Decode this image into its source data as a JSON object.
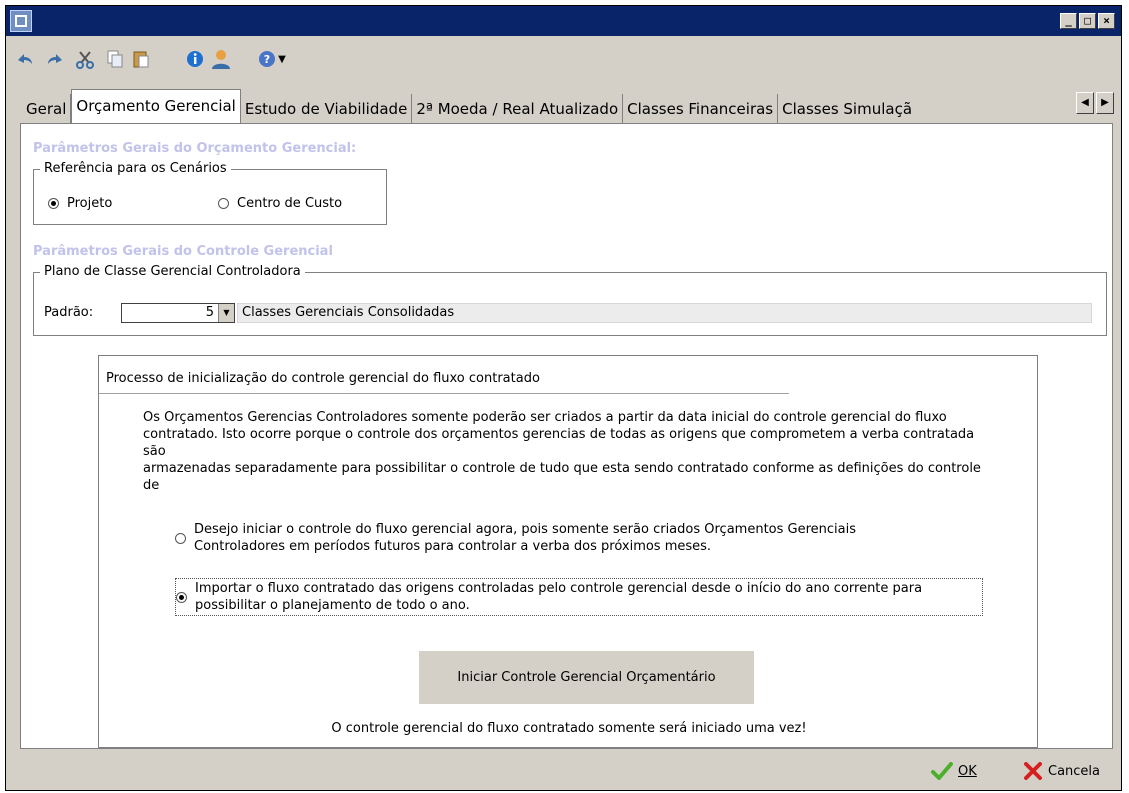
{
  "window": {
    "controls": [
      "_",
      "□",
      "×"
    ]
  },
  "toolbar": {
    "icons": [
      "undo-icon",
      "redo-icon",
      "cut-icon",
      "copy-icon",
      "paste-icon",
      "info-icon",
      "user-icon",
      "help-icon"
    ]
  },
  "tabs": [
    {
      "label": "Geral",
      "active": false
    },
    {
      "label": "Orçamento Gerencial",
      "active": true
    },
    {
      "label": "Estudo de Viabilidade",
      "active": false
    },
    {
      "label": "2ª Moeda / Real Atualizado",
      "active": false
    },
    {
      "label": "Classes Financeiras",
      "active": false
    },
    {
      "label": "Classes Simulaçã",
      "active": false
    }
  ],
  "orcamento": {
    "section_title": "Parâmetros Gerais do Orçamento Gerencial:",
    "group_label": "Referência para os Cenários",
    "options": [
      {
        "label": "Projeto",
        "selected": true
      },
      {
        "label": "Centro de Custo",
        "selected": false
      }
    ]
  },
  "controle": {
    "section_title": "Parâmetros Gerais do Controle Gerencial",
    "group_label": "Plano de Classe Gerencial Controladora",
    "padrao_label": "Padrão:",
    "padrao_value": "5",
    "padrao_desc": "Classes Gerenciais Consolidadas"
  },
  "processo": {
    "title": "Processo de inicialização do controle gerencial do fluxo contratado",
    "lines": [
      "Os Orçamentos Gerencias Controladores somente poderão ser criados a partir da data inicial do controle gerencial do fluxo",
      "contratado.  Isto ocorre porque o controle dos orçamentos gerencias de todas as origens que comprometem a verba contratada",
      "são",
      "armazenadas separadamente para possibilitar o controle de tudo que esta sendo contratado conforme as definições do controle",
      "de"
    ],
    "option1_lines": [
      "Desejo iniciar o controle do fluxo gerencial agora, pois somente serão criados Orçamentos Gerenciais",
      "Controladores em períodos futuros para controlar a verba dos próximos meses."
    ],
    "option2_lines": [
      "Importar o fluxo contratado das origens controladas pelo controle gerencial desde o início do ano corrente para",
      "possibilitar o planejamento de todo o ano."
    ],
    "selected_option": 2,
    "button_label": "Iniciar Controle Gerencial Orçamentário",
    "footer_note": "O controle gerencial do fluxo contratado somente será iniciado uma vez!"
  },
  "footer": {
    "ok_label": "OK",
    "cancel_label": "Cancela"
  },
  "colors": {
    "titlebar": "#0a246a",
    "face": "#d4d0c8",
    "section_title": "#c2c2ea",
    "ok_icon": "#4caf2a",
    "cancel_icon": "#d62020"
  }
}
